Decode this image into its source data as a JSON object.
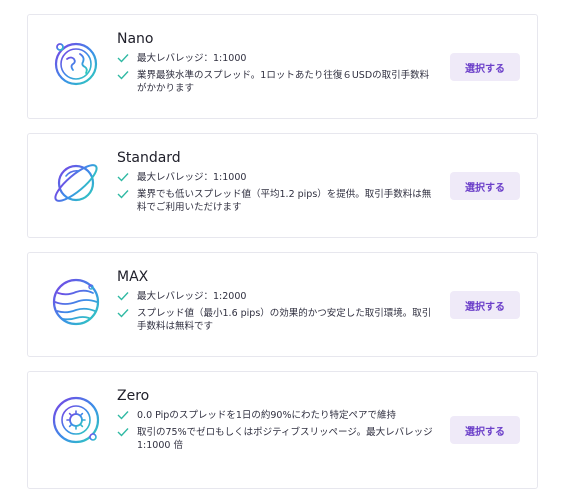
{
  "plans": [
    {
      "name": "Nano",
      "icon": "globe-icon",
      "features": [
        "最大レバレッジ：1:1000",
        "業界最狭水準のスプレッド。1ロットあたり往復６USDの取引手数料がかかります"
      ],
      "button": "選択する"
    },
    {
      "name": "Standard",
      "icon": "planet-ring-icon",
      "features": [
        "最大レバレッジ：1:1000",
        "業界でも低いスプレッド値（平均1.2 pips）を提供。取引手数料は無料でご利用いただけます"
      ],
      "button": "選択する"
    },
    {
      "name": "MAX",
      "icon": "striped-planet-icon",
      "features": [
        "最大レバレッジ：1:2000",
        "スプレッド値（最小1.6 pips）の効果的かつ安定した取引環境。取引手数料は無料です"
      ],
      "button": "選択する"
    },
    {
      "name": "Zero",
      "icon": "sun-orbit-icon",
      "features": [
        "0.0 Pipのスプレッドを1日の約90%にわたり特定ペアで維持",
        "取引の75%でゼロもしくはポジティブスリッページ。最大レバレッジ 1:1000 倍"
      ],
      "button": "選択する"
    }
  ],
  "colors": {
    "accent": "#6b3fc9",
    "check": "#2fb9a3",
    "button_bg": "#efeaf8"
  }
}
